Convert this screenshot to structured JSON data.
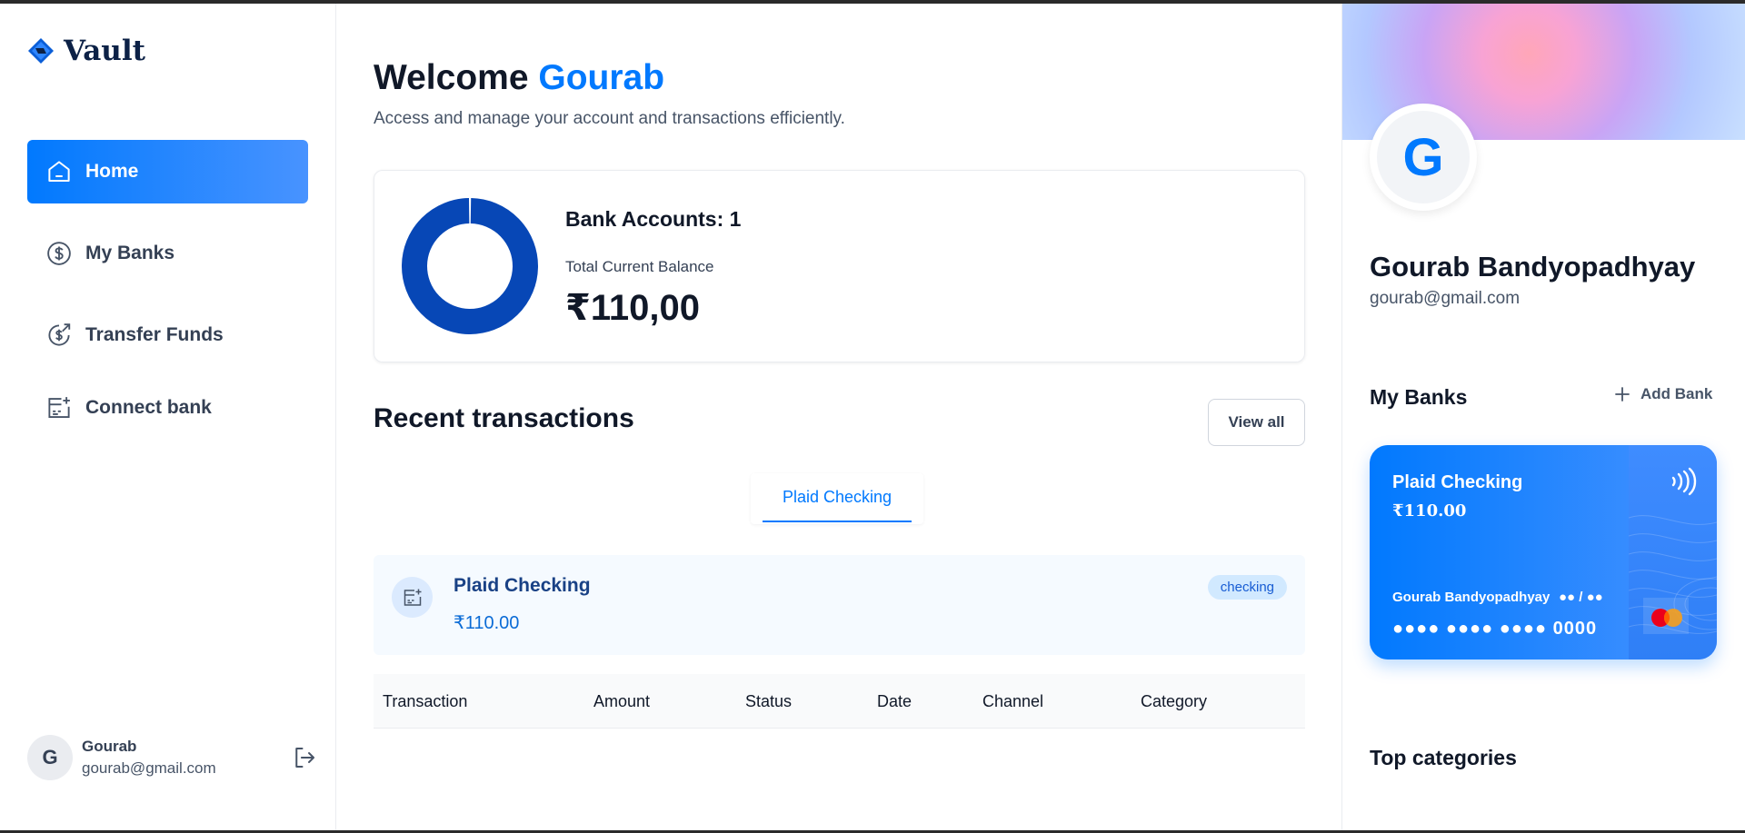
{
  "app": {
    "name": "Vault"
  },
  "sidebar": {
    "items": [
      {
        "label": "Home",
        "icon": "home-icon",
        "active": true
      },
      {
        "label": "My Banks",
        "icon": "dollar-circle-icon",
        "active": false
      },
      {
        "label": "Transfer Funds",
        "icon": "transfer-icon",
        "active": false
      },
      {
        "label": "Connect bank",
        "icon": "connect-bank-icon",
        "active": false
      }
    ],
    "user": {
      "initial": "G",
      "name": "Gourab",
      "email": "gourab@gmail.com"
    }
  },
  "header": {
    "welcome": "Welcome",
    "user_first_name": "Gourab",
    "subtitle": "Access and manage your account and transactions efficiently."
  },
  "balance": {
    "accounts_label": "Bank Accounts: 1",
    "total_label": "Total Current Balance",
    "total_value": "₹110,00"
  },
  "chart_data": {
    "type": "pie",
    "categories": [
      "Plaid Checking"
    ],
    "values": [
      110
    ]
  },
  "recent": {
    "title": "Recent transactions",
    "view_all": "View all",
    "tabs": [
      {
        "label": "Plaid Checking",
        "active": true
      }
    ],
    "bank": {
      "name": "Plaid Checking",
      "balance": "₹110.00",
      "type": "checking"
    },
    "columns": [
      "Transaction",
      "Amount",
      "Status",
      "Date",
      "Channel",
      "Category"
    ]
  },
  "profile": {
    "initial": "G",
    "name": "Gourab Bandyopadhyay",
    "email": "gourab@gmail.com"
  },
  "my_banks": {
    "title": "My Banks",
    "add_label": "Add Bank",
    "card": {
      "name": "Plaid Checking",
      "balance": "₹110.00",
      "holder": "Gourab Bandyopadhyay",
      "expiry": "●● / ●●",
      "number": "●●●● ●●●● ●●●● 0000"
    }
  },
  "top_categories": {
    "title": "Top categories"
  },
  "colors": {
    "accent": "#0179fe",
    "donut": "#0747b6",
    "badge_bg": "#d1e9ff"
  }
}
